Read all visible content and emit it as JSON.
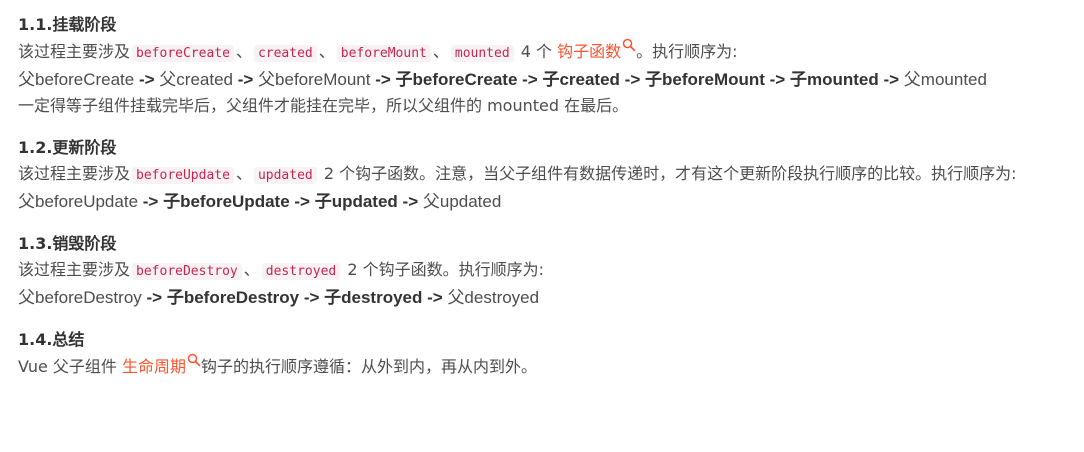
{
  "colors": {
    "text": "#4d4d4d",
    "heading": "#333333",
    "link": "#fc5531",
    "code_text": "#c7254e",
    "code_bg": "#f9f2f4"
  },
  "s1": {
    "heading": "1.1.挂载阶段",
    "intro_a": "该过程主要涉及",
    "code1": "beforeCreate",
    "sep1": "、",
    "code2": "created",
    "sep2": "、",
    "code3": "beforeMount",
    "sep3": "、",
    "code4": "mounted",
    "count": "4 个",
    "link": "钩子函数",
    "intro_b": "。执行顺序为:",
    "flow": {
      "p1": "父beforeCreate",
      "a1": " -> ",
      "p2": "父created",
      "a2": " -> ",
      "p3": "父beforeMount",
      "a3": " -> ",
      "c1": "子beforeCreate",
      "a4": " -> ",
      "c2": "子created",
      "a5": " -> ",
      "c3": "子beforeMount",
      "a6": " -> ",
      "c4": "子mounted",
      "a7": " -> ",
      "p4": "父mounted"
    },
    "note": "一定得等子组件挂载完毕后，父组件才能挂在完毕，所以父组件的 mounted 在最后。"
  },
  "s2": {
    "heading": "1.2.更新阶段",
    "intro_a": "该过程主要涉及",
    "code1": "beforeUpdate",
    "sep1": "、",
    "code2": "updated",
    "intro_b": "2 个钩子函数。注意，当父子组件有数据传递时，才有这个更新阶段执行顺序的比较。执行顺序为:",
    "flow": {
      "p1": "父beforeUpdate",
      "a1": " -> ",
      "c1": "子beforeUpdate",
      "a2": " -> ",
      "c2": "子updated",
      "a3": " -> ",
      "p2": "父updated"
    }
  },
  "s3": {
    "heading": "1.3.销毁阶段",
    "intro_a": "该过程主要涉及",
    "code1": "beforeDestroy",
    "sep1": "、",
    "code2": "destroyed",
    "intro_b": "2 个钩子函数。执行顺序为:",
    "flow": {
      "p1": "父beforeDestroy",
      "a1": " -> ",
      "c1": "子beforeDestroy",
      "a2": " -> ",
      "c2": "子destroyed",
      "a3": " -> ",
      "p2": "父destroyed"
    }
  },
  "s4": {
    "heading": "1.4.总结",
    "intro_a": "Vue 父子组件",
    "link": "生命周期",
    "intro_b": "钩子的执行顺序遵循：从外到内，再从内到外。"
  }
}
